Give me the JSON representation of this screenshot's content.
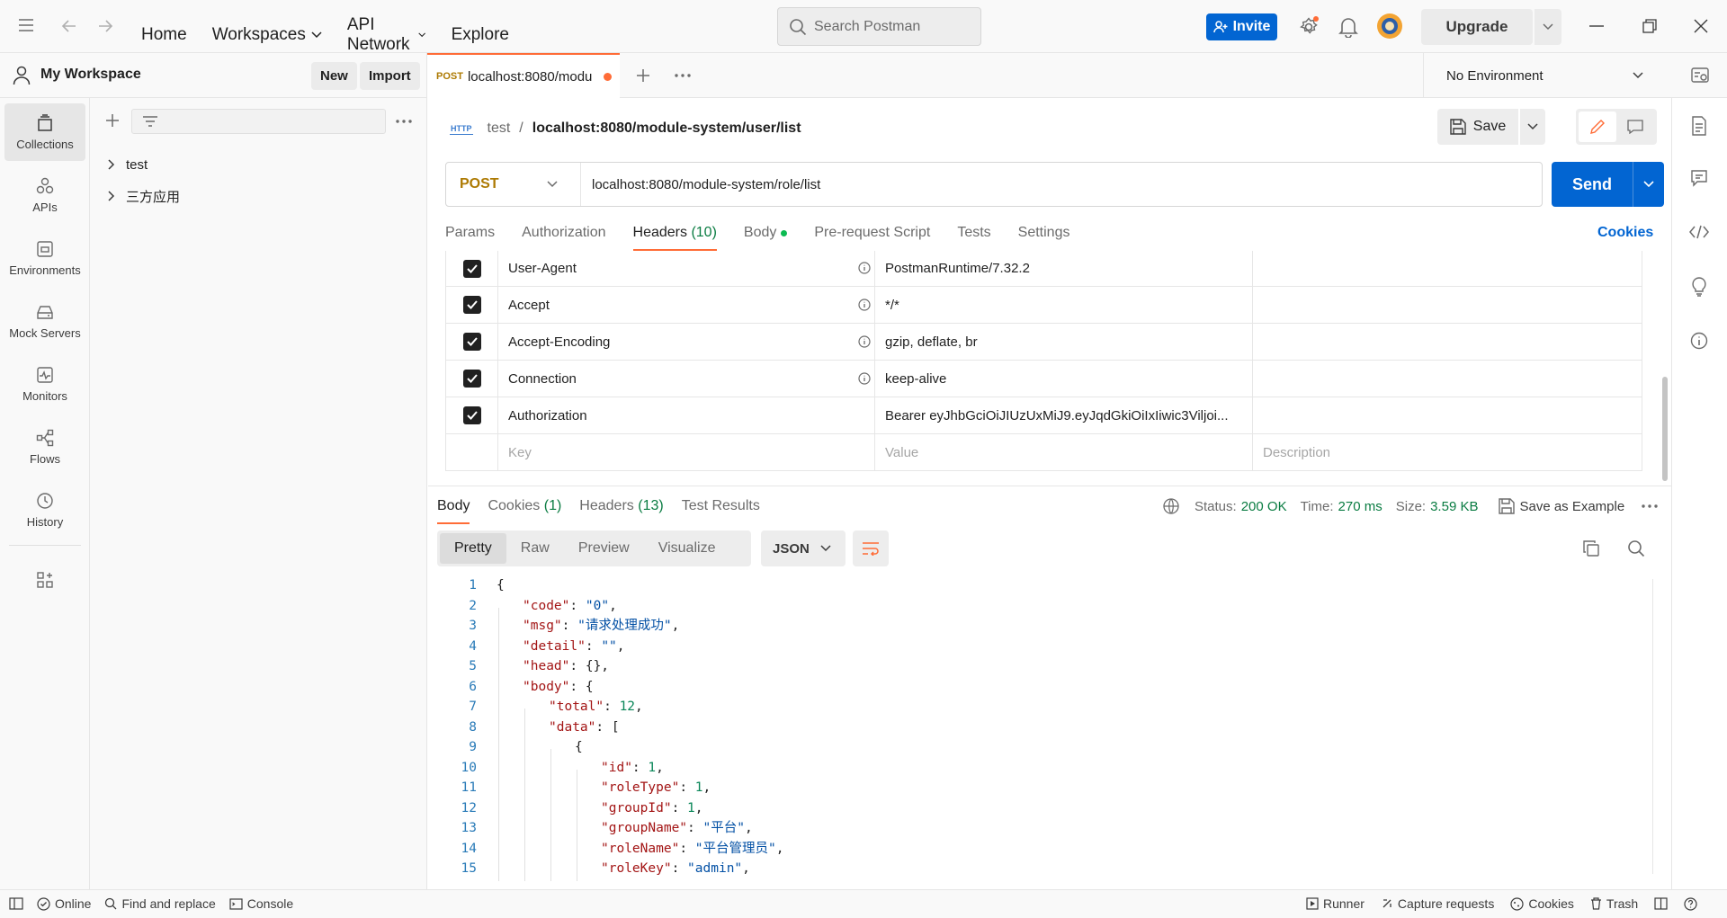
{
  "topbar": {
    "nav": [
      "Home",
      "Workspaces",
      "API Network",
      "Explore"
    ],
    "search_placeholder": "Search Postman",
    "invite": "Invite",
    "upgrade": "Upgrade"
  },
  "workspace": {
    "title": "My Workspace",
    "new_label": "New",
    "import_label": "Import"
  },
  "rail": [
    {
      "label": "Collections",
      "icon": "collections-icon"
    },
    {
      "label": "APIs",
      "icon": "apis-icon"
    },
    {
      "label": "Environments",
      "icon": "environments-icon"
    },
    {
      "label": "Mock Servers",
      "icon": "mock-servers-icon"
    },
    {
      "label": "Monitors",
      "icon": "monitors-icon"
    },
    {
      "label": "Flows",
      "icon": "flows-icon"
    },
    {
      "label": "History",
      "icon": "history-icon"
    }
  ],
  "collections": [
    "test",
    "三方应用"
  ],
  "tab": {
    "method": "POST",
    "title": "localhost:8080/modu"
  },
  "environment": "No Environment",
  "breadcrumb": {
    "collection": "test",
    "separator": "/",
    "request": "localhost:8080/module-system/user/list"
  },
  "save_label": "Save",
  "request": {
    "method": "POST",
    "url": "localhost:8080/module-system/role/list",
    "send_label": "Send"
  },
  "request_tabs": {
    "params": "Params",
    "authorization": "Authorization",
    "headers": "Headers",
    "headers_count": "(10)",
    "body": "Body",
    "prerequest": "Pre-request Script",
    "tests": "Tests",
    "settings": "Settings",
    "cookies": "Cookies"
  },
  "headers": [
    {
      "key": "User-Agent",
      "value": "PostmanRuntime/7.32.2",
      "info": true
    },
    {
      "key": "Accept",
      "value": "*/*",
      "info": true
    },
    {
      "key": "Accept-Encoding",
      "value": "gzip, deflate, br",
      "info": true
    },
    {
      "key": "Connection",
      "value": "keep-alive",
      "info": true
    },
    {
      "key": "Authorization",
      "value": "Bearer eyJhbGciOiJIUzUxMiJ9.eyJqdGkiOiIxIiwic3Viljoi...",
      "info": false
    }
  ],
  "headers_placeholder": {
    "key": "Key",
    "value": "Value",
    "description": "Description"
  },
  "response": {
    "tabs": {
      "body": "Body",
      "cookies": "Cookies",
      "cookies_count": "(1)",
      "headers": "Headers",
      "headers_count": "(13)",
      "test_results": "Test Results"
    },
    "status_label": "Status:",
    "status": "200 OK",
    "time_label": "Time:",
    "time": "270 ms",
    "size_label": "Size:",
    "size": "3.59 KB",
    "save_example": "Save as Example",
    "views": [
      "Pretty",
      "Raw",
      "Preview",
      "Visualize"
    ],
    "format": "JSON"
  },
  "code_lines": [
    {
      "n": "1",
      "indent": 0,
      "parts": [
        [
          "p",
          "{"
        ]
      ]
    },
    {
      "n": "2",
      "indent": 1,
      "parts": [
        [
          "k",
          "\"code\""
        ],
        [
          "p",
          ": "
        ],
        [
          "s",
          "\"0\""
        ],
        [
          "p",
          ","
        ]
      ]
    },
    {
      "n": "3",
      "indent": 1,
      "parts": [
        [
          "k",
          "\"msg\""
        ],
        [
          "p",
          ": "
        ],
        [
          "s",
          "\"请求处理成功\""
        ],
        [
          "p",
          ","
        ]
      ]
    },
    {
      "n": "4",
      "indent": 1,
      "parts": [
        [
          "k",
          "\"detail\""
        ],
        [
          "p",
          ": "
        ],
        [
          "s",
          "\"\""
        ],
        [
          "p",
          ","
        ]
      ]
    },
    {
      "n": "5",
      "indent": 1,
      "parts": [
        [
          "k",
          "\"head\""
        ],
        [
          "p",
          ": {},"
        ]
      ]
    },
    {
      "n": "6",
      "indent": 1,
      "parts": [
        [
          "k",
          "\"body\""
        ],
        [
          "p",
          ": {"
        ]
      ]
    },
    {
      "n": "7",
      "indent": 2,
      "parts": [
        [
          "k",
          "\"total\""
        ],
        [
          "p",
          ": "
        ],
        [
          "n",
          "12"
        ],
        [
          "p",
          ","
        ]
      ]
    },
    {
      "n": "8",
      "indent": 2,
      "parts": [
        [
          "k",
          "\"data\""
        ],
        [
          "p",
          ": ["
        ]
      ]
    },
    {
      "n": "9",
      "indent": 3,
      "parts": [
        [
          "p",
          "{"
        ]
      ]
    },
    {
      "n": "10",
      "indent": 4,
      "parts": [
        [
          "k",
          "\"id\""
        ],
        [
          "p",
          ": "
        ],
        [
          "n",
          "1"
        ],
        [
          "p",
          ","
        ]
      ]
    },
    {
      "n": "11",
      "indent": 4,
      "parts": [
        [
          "k",
          "\"roleType\""
        ],
        [
          "p",
          ": "
        ],
        [
          "n",
          "1"
        ],
        [
          "p",
          ","
        ]
      ]
    },
    {
      "n": "12",
      "indent": 4,
      "parts": [
        [
          "k",
          "\"groupId\""
        ],
        [
          "p",
          ": "
        ],
        [
          "n",
          "1"
        ],
        [
          "p",
          ","
        ]
      ]
    },
    {
      "n": "13",
      "indent": 4,
      "parts": [
        [
          "k",
          "\"groupName\""
        ],
        [
          "p",
          ": "
        ],
        [
          "s",
          "\"平台\""
        ],
        [
          "p",
          ","
        ]
      ]
    },
    {
      "n": "14",
      "indent": 4,
      "parts": [
        [
          "k",
          "\"roleName\""
        ],
        [
          "p",
          ": "
        ],
        [
          "s",
          "\"平台管理员\""
        ],
        [
          "p",
          ","
        ]
      ]
    },
    {
      "n": "15",
      "indent": 4,
      "parts": [
        [
          "k",
          "\"roleKey\""
        ],
        [
          "p",
          ": "
        ],
        [
          "s",
          "\"admin\""
        ],
        [
          "p",
          ","
        ]
      ]
    }
  ],
  "statusbar": {
    "online": "Online",
    "find_replace": "Find and replace",
    "console": "Console",
    "runner": "Runner",
    "capture": "Capture requests",
    "cookies": "Cookies",
    "trash": "Trash"
  },
  "colors": {
    "accent": "#ff6c37",
    "primary": "#0265d2",
    "status_ok": "#0a7c42"
  }
}
